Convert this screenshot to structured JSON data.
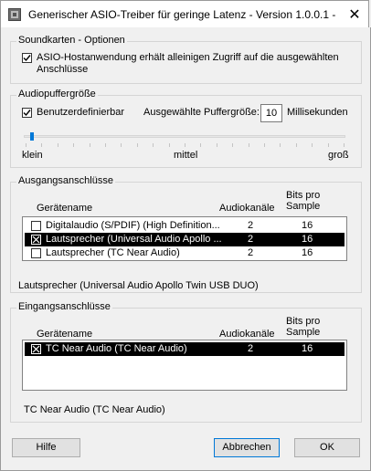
{
  "window": {
    "title": "Generischer ASIO-Treiber für geringe Latenz - Version 1.0.0.1 - x..."
  },
  "soundcard": {
    "legend": "Soundkarten - Optionen",
    "exclusive_label_line1": "ASIO-Hostanwendung erhält alleinigen Zugriff auf die ausgewählten",
    "exclusive_label_line2": "Anschlüsse",
    "exclusive_checked": true
  },
  "buffer": {
    "legend": "Audiopuffergröße",
    "custom_label": "Benutzerdefinierbar",
    "custom_checked": true,
    "selected_label": "Ausgewählte Puffergröße:",
    "value": "10",
    "unit": "Millisekunden",
    "slider_fraction": 0.02,
    "min_label": "klein",
    "mid_label": "mittel",
    "max_label": "groß"
  },
  "outputs": {
    "legend": "Ausgangsanschlüsse",
    "col_device": "Gerätename",
    "col_channels": "Audiokanäle",
    "col_bits_line1": "Bits pro",
    "col_bits_line2": "Sample",
    "rows": [
      {
        "name": "Digitalaudio (S/PDIF) (High Definition...",
        "channels": "2",
        "bits": "16",
        "checked": false,
        "selected": false
      },
      {
        "name": "Lautsprecher (Universal Audio Apollo ...",
        "channels": "2",
        "bits": "16",
        "checked": true,
        "selected": true
      },
      {
        "name": "Lautsprecher (TC Near Audio)",
        "channels": "2",
        "bits": "16",
        "checked": false,
        "selected": false
      }
    ],
    "status": "Lautsprecher (Universal Audio Apollo Twin USB DUO)"
  },
  "inputs": {
    "legend": "Eingangsanschlüsse",
    "col_device": "Gerätename",
    "col_channels": "Audiokanäle",
    "col_bits_line1": "Bits pro",
    "col_bits_line2": "Sample",
    "rows": [
      {
        "name": "TC Near Audio (TC Near Audio)",
        "channels": "2",
        "bits": "16",
        "checked": true,
        "selected": true
      }
    ],
    "status": "TC Near Audio (TC Near Audio)"
  },
  "buttons": {
    "help": "Hilfe",
    "cancel": "Abbrechen",
    "ok": "OK"
  },
  "colors": {
    "selection": "#000000",
    "accent": "#0078d7"
  }
}
